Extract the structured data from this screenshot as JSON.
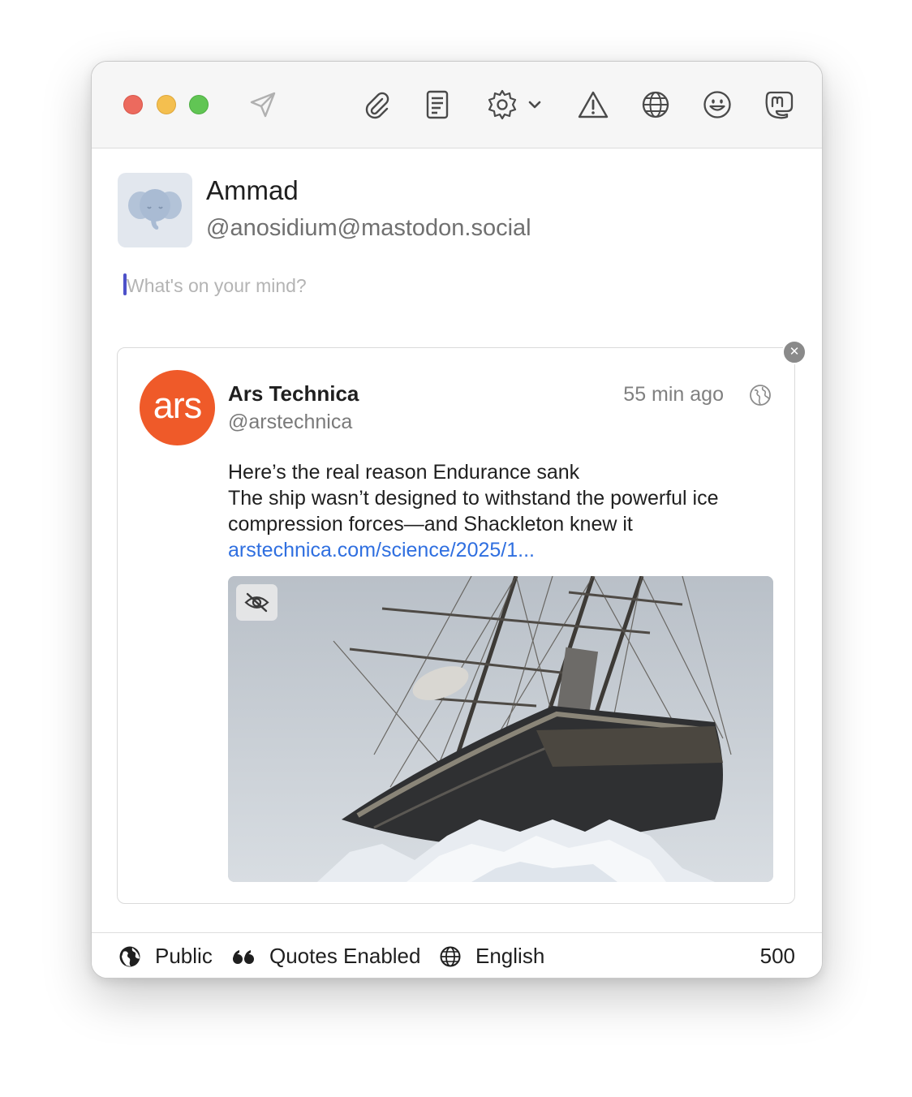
{
  "toolbar": {
    "icons": [
      "send-icon",
      "attach-icon",
      "draft-icon",
      "gear-icon",
      "chevron-down-icon",
      "warning-icon",
      "globe-icon",
      "emoji-icon",
      "mastodon-icon"
    ]
  },
  "account": {
    "display_name": "Ammad",
    "handle": "@anosidium@mastodon.social"
  },
  "compose": {
    "placeholder": "What's on your mind?",
    "value": ""
  },
  "quote": {
    "logo_text": "ars",
    "name": "Ars Technica",
    "handle": "@arstechnica",
    "time": "55 min ago",
    "remove_symbol": "✕",
    "text_lines": [
      "Here’s the real reason Endurance sank",
      "The ship wasn’t designed to withstand the powerful ice",
      "compression forces—and Shackleton knew it"
    ],
    "link": "arstechnica.com/science/2025/1..."
  },
  "footer": {
    "visibility": "Public",
    "quotes": "Quotes Enabled",
    "language": "English",
    "char_count": "500"
  },
  "colors": {
    "accent": "#4d51c9",
    "link": "#2f6fe0",
    "ars_brand": "#ef5a29"
  }
}
